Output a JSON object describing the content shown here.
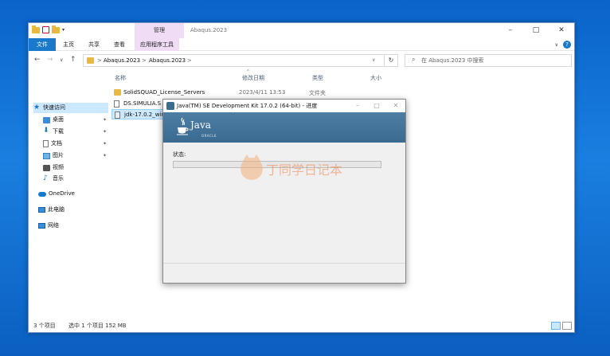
{
  "window": {
    "title": "Abaqus.2023",
    "contextual_tab_group": "管理",
    "controls": [
      "–",
      "□",
      "✕"
    ]
  },
  "ribbon": {
    "tabs": [
      "文件",
      "主页",
      "共享",
      "查看",
      "应用程序工具"
    ]
  },
  "address": {
    "back": "←",
    "forward": "→",
    "recent": "∨",
    "up": "↑",
    "separator": ">",
    "breadcrumb": [
      "Abaqus.2023",
      "Abaqus.2023"
    ],
    "refresh": "↻",
    "search_placeholder": "在 Abaqus.2023 中搜索"
  },
  "nav": {
    "items": [
      {
        "label": "快速访问",
        "icon": "star-icon"
      },
      {
        "label": "桌面",
        "icon": "desktop-icon"
      },
      {
        "label": "下载",
        "icon": "download-icon"
      },
      {
        "label": "文档",
        "icon": "document-icon"
      },
      {
        "label": "图片",
        "icon": "picture-icon"
      },
      {
        "label": "视频",
        "icon": "video-icon"
      },
      {
        "label": "音乐",
        "icon": "music-icon"
      },
      {
        "label": "OneDrive",
        "icon": "onedrive-icon"
      },
      {
        "label": "此电脑",
        "icon": "this-pc-icon"
      },
      {
        "label": "网络",
        "icon": "network-icon"
      }
    ]
  },
  "files": {
    "columns": [
      "名称",
      "修改日期",
      "类型",
      "大小"
    ],
    "rows": [
      {
        "name": "SolidSQUAD_License_Servers",
        "date": "2023/4/11 13:53",
        "type": "文件夹",
        "icon": "folder-icon"
      },
      {
        "name": "DS.SIMULIA.S",
        "date": "",
        "type": "",
        "icon": "file-icon"
      },
      {
        "name": "jdk-17.0.2_win",
        "date": "",
        "type": "",
        "icon": "installer-icon"
      }
    ]
  },
  "status": {
    "item_count": "3 个项目",
    "selection": "选中 1 个项目  152 MB"
  },
  "dialog": {
    "title": "Java(TM) SE Development Kit 17.0.2 (64-bit) - 进度",
    "logo_word": "Java",
    "logo_sub": "ORACLE",
    "status_label": "状态:",
    "progress_fraction": 0.0
  },
  "watermark": {
    "text": "丁同学日记本"
  },
  "colors": {
    "accent": "#1979ca",
    "progress": "#06b025",
    "java_banner": "#3b6a91"
  }
}
